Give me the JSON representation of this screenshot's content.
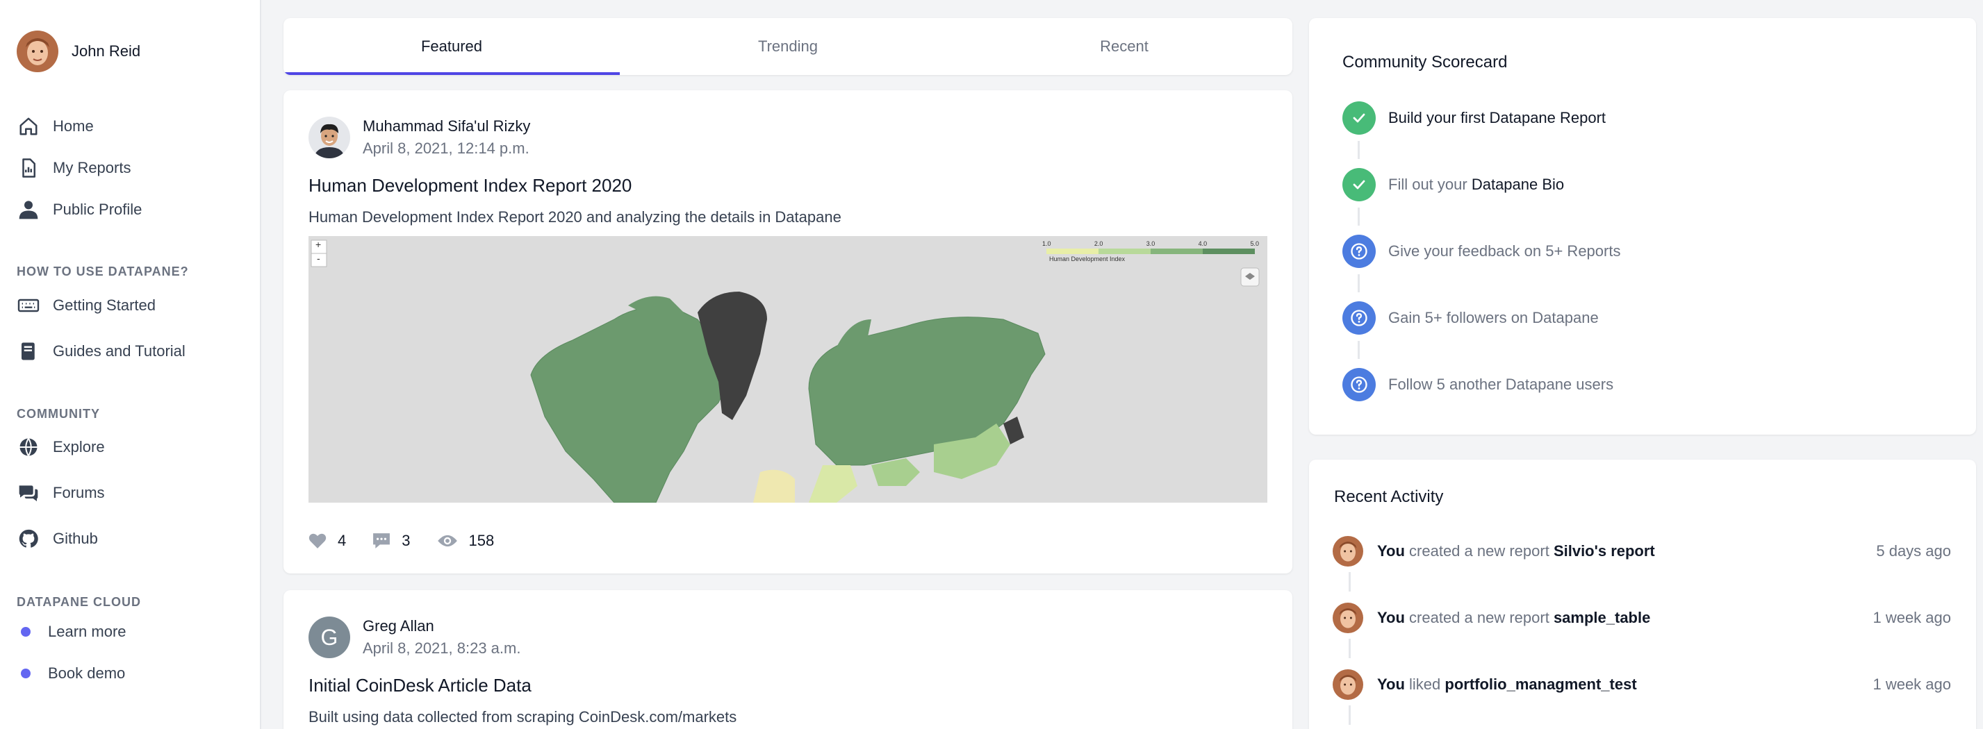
{
  "user": {
    "name": "John Reid"
  },
  "nav": [
    {
      "label": "Home",
      "icon": "home-icon"
    },
    {
      "label": "My Reports",
      "icon": "document-icon"
    },
    {
      "label": "Public Profile",
      "icon": "person-icon"
    }
  ],
  "sections": {
    "how_to": {
      "title": "HOW TO USE DATAPANE?",
      "items": [
        {
          "label": "Getting Started",
          "icon": "keyboard-icon"
        },
        {
          "label": "Guides and Tutorial",
          "icon": "book-icon"
        }
      ]
    },
    "community": {
      "title": "COMMUNITY",
      "items": [
        {
          "label": "Explore",
          "icon": "globe-icon"
        },
        {
          "label": "Forums",
          "icon": "chat-icon"
        },
        {
          "label": "Github",
          "icon": "github-icon"
        }
      ]
    },
    "cloud": {
      "title": "DATAPANE CLOUD",
      "items": [
        {
          "label": "Learn more"
        },
        {
          "label": "Book demo"
        }
      ]
    }
  },
  "tabs": [
    "Featured",
    "Trending",
    "Recent"
  ],
  "posts": [
    {
      "author": "Muhammad Sifa'ul Rizky",
      "date": "April 8, 2021, 12:14 p.m.",
      "title": "Human Development Index Report 2020",
      "description": "Human Development Index Report 2020 and analyzing the details in Datapane",
      "map": {
        "zoom_in": "+",
        "zoom_out": "-",
        "legend_ticks": [
          "1.0",
          "2.0",
          "3.0",
          "4.0",
          "5.0"
        ],
        "legend_caption": "Human Development Index"
      },
      "likes": "4",
      "comments": "3",
      "views": "158"
    },
    {
      "author": "Greg Allan",
      "author_initial": "G",
      "date": "April 8, 2021, 8:23 a.m.",
      "title": "Initial CoinDesk Article Data",
      "description": "Built using data collected from scraping CoinDesk.com/markets"
    }
  ],
  "scorecard": {
    "title": "Community Scorecard",
    "steps": [
      {
        "text": "Build your first Datapane Report",
        "bold": "",
        "done": true
      },
      {
        "text": "Fill out your ",
        "bold": "Datapane Bio",
        "done": true
      },
      {
        "text": "Give your feedback on 5+ Reports",
        "bold": "",
        "done": false
      },
      {
        "text": "Gain 5+ followers on Datapane",
        "bold": "",
        "done": false
      },
      {
        "text": "Follow 5 another Datapane users",
        "bold": "",
        "done": false
      }
    ]
  },
  "activity": {
    "title": "Recent Activity",
    "items": [
      {
        "actor": "You",
        "action": " created a new report ",
        "target": "Silvio's report",
        "time": "5 days ago"
      },
      {
        "actor": "You",
        "action": " created a new report ",
        "target": "sample_table",
        "time": "1 week ago"
      },
      {
        "actor": "You",
        "action": " liked ",
        "target": "portfolio_managment_test",
        "time": "1 week ago"
      }
    ]
  },
  "colors": {
    "accent": "#4f46e5",
    "done": "#48bb78",
    "todo": "#4c7ce0",
    "dot": "#6366f1"
  }
}
